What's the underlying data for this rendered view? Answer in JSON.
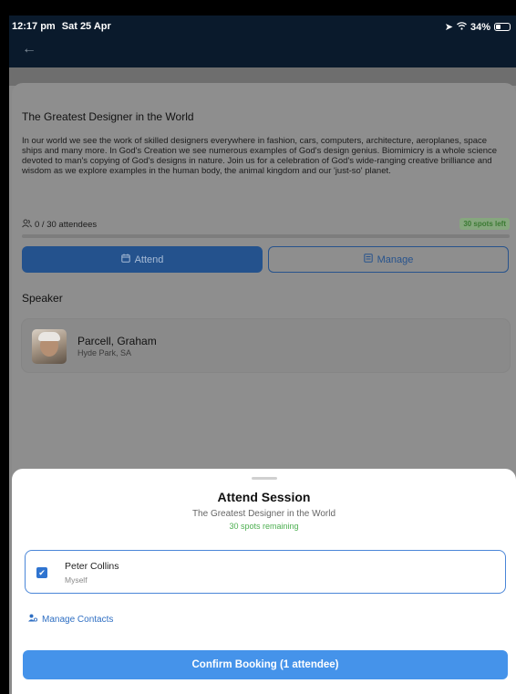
{
  "status_bar": {
    "time": "12:17 pm",
    "date": "Sat 25 Apr",
    "location_icon": "location-arrow-icon",
    "wifi_icon": "wifi-icon",
    "battery_pct": "34%",
    "battery_level": 0.34
  },
  "app_bar": {
    "back_icon": "back-arrow-icon"
  },
  "session": {
    "title": "The Greatest Designer in the World",
    "description": "In our world we see the work of skilled designers everywhere in fashion, cars, computers, architecture, aeroplanes, space ships and many more. In God's Creation we see numerous examples of God's design genius. Biomimicry is a whole science devoted to man's copying of God's designs in nature. Join us for a celebration of God's wide-ranging creative brilliance and wisdom as we explore examples in the human body, the animal kingdom and our 'just-so' planet.",
    "attendees_text": "0 / 30 attendees",
    "attendees_icon": "people-icon",
    "spots_left": "30 spots left",
    "fill_fraction": 0.0,
    "attend_label": "Attend",
    "manage_label": "Manage",
    "speaker_heading": "Speaker",
    "speaker": {
      "name": "Parcell, Graham",
      "location": "Hyde Park, SA"
    }
  },
  "sheet": {
    "title": "Attend Session",
    "subtitle": "The Greatest Designer in the World",
    "spots_remaining": "30 spots remaining",
    "attendee": {
      "name": "Peter Collins",
      "relation": "Myself",
      "checked": true
    },
    "manage_contacts": "Manage Contacts",
    "confirm": "Confirm Booking (1 attendee)"
  },
  "colors": {
    "app_bar": "#0a1a2c",
    "primary": "#4593ea",
    "success": "#4caf50"
  }
}
